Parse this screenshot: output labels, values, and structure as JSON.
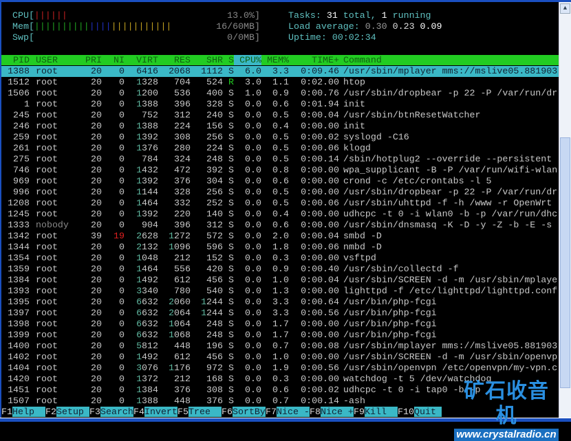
{
  "meters": {
    "cpu": {
      "label": "CPU[",
      "value": "13.0%]",
      "bars": [
        [
          "#c02020",
          6
        ]
      ]
    },
    "mem": {
      "label": "Mem[",
      "value": "16/60MB]",
      "bars": [
        [
          "#20a020",
          10
        ],
        [
          "#2030c0",
          4
        ],
        [
          "#c0a020",
          11
        ]
      ]
    },
    "swp": {
      "label": "Swp[",
      "value": "0/0MB]",
      "bars": []
    }
  },
  "info": {
    "tasks_label": "Tasks: ",
    "tasks_total": "31",
    "tasks_mid": " total, ",
    "tasks_running": "1",
    "tasks_end": " running",
    "load_label": "Load average: ",
    "load1": "0.30",
    "load5": "0.23",
    "load15": "0.09",
    "uptime_label": "Uptime: ",
    "uptime": "00:02:34"
  },
  "columns": [
    "PID",
    "USER",
    "PRI",
    "NI",
    "VIRT",
    "RES",
    "SHR",
    "S",
    "CPU%",
    "MEM%",
    "TIME+",
    "Command"
  ],
  "selected_pid": "1388",
  "processes": [
    [
      "1388",
      "root",
      "20",
      "0",
      "6416",
      "2068",
      "1112",
      "S",
      "6.0",
      "3.3",
      "0:09.46",
      "/usr/sbin/mplayer mms://mslive05.881903"
    ],
    [
      "1512",
      "root",
      "20",
      "0",
      "1328",
      "704",
      "524",
      "R",
      "3.0",
      "1.1",
      "0:02.00",
      "htop"
    ],
    [
      "1506",
      "root",
      "20",
      "0",
      "1200",
      "536",
      "400",
      "S",
      "1.0",
      "0.9",
      "0:00.76",
      "/usr/sbin/dropbear -p 22 -P /var/run/dr"
    ],
    [
      "1",
      "root",
      "20",
      "0",
      "1388",
      "396",
      "328",
      "S",
      "0.0",
      "0.6",
      "0:01.94",
      "init"
    ],
    [
      "245",
      "root",
      "20",
      "0",
      "752",
      "312",
      "240",
      "S",
      "0.0",
      "0.5",
      "0:00.04",
      "/usr/sbin/btnResetWatcher"
    ],
    [
      "246",
      "root",
      "20",
      "0",
      "1388",
      "224",
      "156",
      "S",
      "0.0",
      "0.4",
      "0:00.00",
      "init"
    ],
    [
      "259",
      "root",
      "20",
      "0",
      "1392",
      "308",
      "256",
      "S",
      "0.0",
      "0.5",
      "0:00.02",
      "syslogd -C16"
    ],
    [
      "261",
      "root",
      "20",
      "0",
      "1376",
      "280",
      "224",
      "S",
      "0.0",
      "0.5",
      "0:00.06",
      "klogd"
    ],
    [
      "275",
      "root",
      "20",
      "0",
      "784",
      "324",
      "248",
      "S",
      "0.0",
      "0.5",
      "0:00.14",
      "/sbin/hotplug2 --override --persistent"
    ],
    [
      "746",
      "root",
      "20",
      "0",
      "1432",
      "472",
      "392",
      "S",
      "0.0",
      "0.8",
      "0:00.00",
      "wpa_supplicant -B -P /var/run/wifi-wlan"
    ],
    [
      "969",
      "root",
      "20",
      "0",
      "1392",
      "376",
      "304",
      "S",
      "0.0",
      "0.6",
      "0:00.00",
      "crond -c /etc/crontabs -l 5"
    ],
    [
      "996",
      "root",
      "20",
      "0",
      "1144",
      "328",
      "256",
      "S",
      "0.0",
      "0.5",
      "0:00.00",
      "/usr/sbin/dropbear -p 22 -P /var/run/dr"
    ],
    [
      "1208",
      "root",
      "20",
      "0",
      "1464",
      "332",
      "252",
      "S",
      "0.0",
      "0.5",
      "0:00.06",
      "/usr/sbin/uhttpd -f -h /www -r OpenWrt"
    ],
    [
      "1245",
      "root",
      "20",
      "0",
      "1392",
      "220",
      "140",
      "S",
      "0.0",
      "0.4",
      "0:00.00",
      "udhcpc -t 0 -i wlan0 -b -p /var/run/dhc"
    ],
    [
      "1333",
      "nobody",
      "20",
      "0",
      "904",
      "396",
      "312",
      "S",
      "0.0",
      "0.6",
      "0:00.00",
      "/usr/sbin/dnsmasq -K -D -y -Z -b -E -s"
    ],
    [
      "1342",
      "root",
      "39",
      "19",
      "2628",
      "1272",
      "572",
      "S",
      "0.0",
      "2.0",
      "0:00.04",
      "smbd -D"
    ],
    [
      "1344",
      "root",
      "20",
      "0",
      "2132",
      "1096",
      "596",
      "S",
      "0.0",
      "1.8",
      "0:00.06",
      "nmbd -D"
    ],
    [
      "1354",
      "root",
      "20",
      "0",
      "1048",
      "212",
      "152",
      "S",
      "0.0",
      "0.3",
      "0:00.00",
      "vsftpd"
    ],
    [
      "1359",
      "root",
      "20",
      "0",
      "1464",
      "556",
      "420",
      "S",
      "0.0",
      "0.9",
      "0:00.40",
      "/usr/sbin/collectd -f"
    ],
    [
      "1384",
      "root",
      "20",
      "0",
      "1492",
      "612",
      "456",
      "S",
      "0.0",
      "1.0",
      "0:00.04",
      "/usr/sbin/SCREEN -d -m /usr/sbin/mplaye"
    ],
    [
      "1393",
      "root",
      "20",
      "0",
      "3340",
      "780",
      "540",
      "S",
      "0.0",
      "1.3",
      "0:00.00",
      "lighttpd -f /etc/lighttpd/lighttpd.conf"
    ],
    [
      "1395",
      "root",
      "20",
      "0",
      "6632",
      "2060",
      "1244",
      "S",
      "0.0",
      "3.3",
      "0:00.64",
      "/usr/bin/php-fcgi"
    ],
    [
      "1397",
      "root",
      "20",
      "0",
      "6632",
      "2064",
      "1244",
      "S",
      "0.0",
      "3.3",
      "0:00.56",
      "/usr/bin/php-fcgi"
    ],
    [
      "1398",
      "root",
      "20",
      "0",
      "6632",
      "1064",
      "248",
      "S",
      "0.0",
      "1.7",
      "0:00.00",
      "/usr/bin/php-fcgi"
    ],
    [
      "1399",
      "root",
      "20",
      "0",
      "6632",
      "1068",
      "248",
      "S",
      "0.0",
      "1.7",
      "0:00.00",
      "/usr/bin/php-fcgi"
    ],
    [
      "1400",
      "root",
      "20",
      "0",
      "5812",
      "448",
      "196",
      "S",
      "0.0",
      "0.7",
      "0:00.08",
      "/usr/sbin/mplayer mms://mslive05.881903"
    ],
    [
      "1402",
      "root",
      "20",
      "0",
      "1492",
      "612",
      "456",
      "S",
      "0.0",
      "1.0",
      "0:00.00",
      "/usr/sbin/SCREEN -d -m /usr/sbin/openvp"
    ],
    [
      "1404",
      "root",
      "20",
      "0",
      "3076",
      "1176",
      "972",
      "S",
      "0.0",
      "1.9",
      "0:00.56",
      "/usr/sbin/openvpn /etc/openvpn/my-vpn.c"
    ],
    [
      "1420",
      "root",
      "20",
      "0",
      "1372",
      "212",
      "168",
      "S",
      "0.0",
      "0.3",
      "0:00.00",
      "watchdog -t 5 /dev/watchdog"
    ],
    [
      "1451",
      "root",
      "20",
      "0",
      "1384",
      "376",
      "308",
      "S",
      "0.0",
      "0.6",
      "0:00.02",
      "udhcpc -t 0 -i tap0 -b -p"
    ],
    [
      "1507",
      "root",
      "20",
      "0",
      "1388",
      "448",
      "376",
      "S",
      "0.0",
      "0.7",
      "0:00.14",
      "-ash"
    ]
  ],
  "function_keys": [
    {
      "key": "F1",
      "label": "Help"
    },
    {
      "key": "F2",
      "label": "Setup"
    },
    {
      "key": "F3",
      "label": "Search"
    },
    {
      "key": "F4",
      "label": "Invert"
    },
    {
      "key": "F5",
      "label": "Tree"
    },
    {
      "key": "F6",
      "label": "SortBy"
    },
    {
      "key": "F7",
      "label": "Nice -"
    },
    {
      "key": "F8",
      "label": "Nice +"
    },
    {
      "key": "F9",
      "label": "Kill"
    },
    {
      "key": "F10",
      "label": "Quit"
    }
  ],
  "watermark": {
    "title": "矿石收音机",
    "url": "www.crystalradio.cn"
  }
}
